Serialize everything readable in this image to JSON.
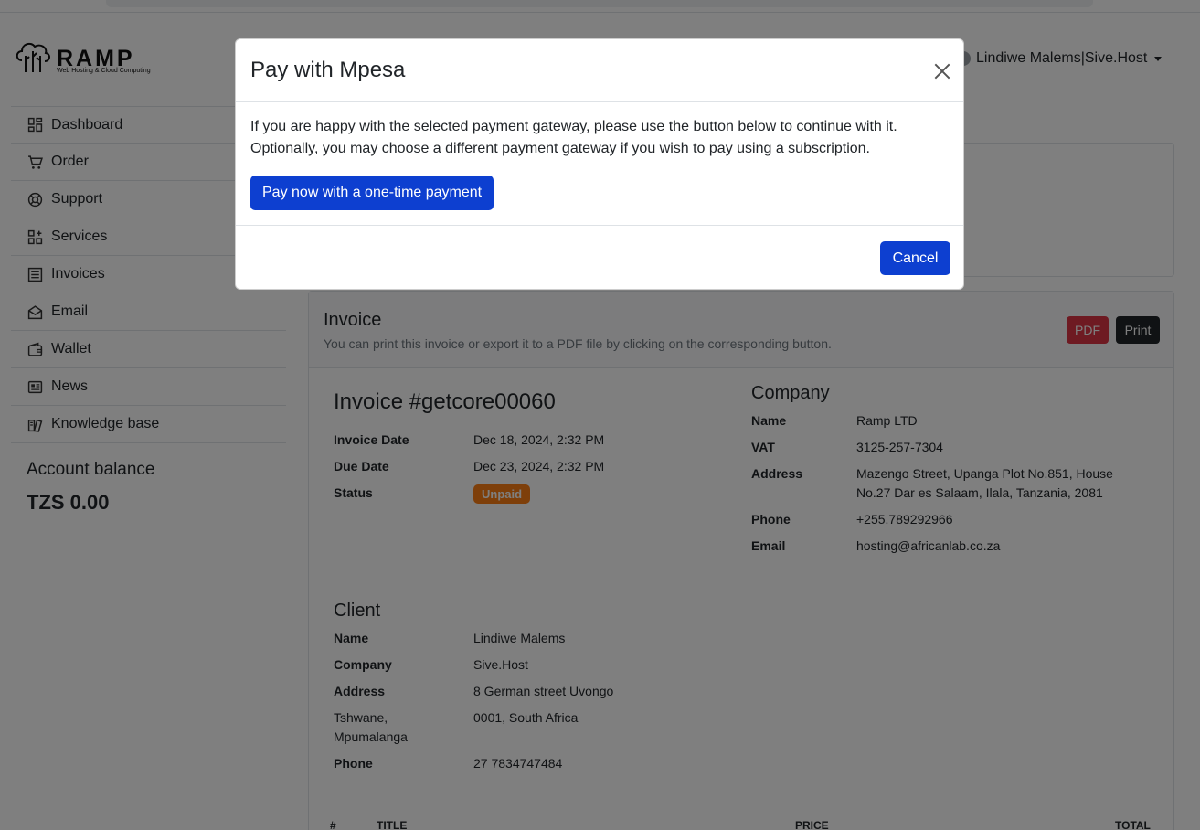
{
  "brand": {
    "name": "RAMP",
    "tagline": "Web Hosting & Cloud Computing"
  },
  "user_menu": {
    "label": "Lindiwe Malems|Sive.Host"
  },
  "sidebar": {
    "items": [
      {
        "label": "Dashboard",
        "icon": "dashboard-icon"
      },
      {
        "label": "Order",
        "icon": "cart-icon"
      },
      {
        "label": "Support",
        "icon": "lifebuoy-icon"
      },
      {
        "label": "Services",
        "icon": "grid-plus-icon"
      },
      {
        "label": "Invoices",
        "icon": "list-icon"
      },
      {
        "label": "Email",
        "icon": "envelope-open-icon"
      },
      {
        "label": "Wallet",
        "icon": "wallet-icon"
      },
      {
        "label": "News",
        "icon": "newspaper-icon"
      },
      {
        "label": "Knowledge base",
        "icon": "book-icon"
      }
    ],
    "balance_label": "Account balance",
    "balance_value": "TZS 0.00"
  },
  "invoice_card": {
    "title": "Invoice",
    "subtitle": "You can print this invoice or export it to a PDF file by clicking on the corresponding button.",
    "pdf_label": "PDF",
    "print_label": "Print"
  },
  "invoice": {
    "title": "Invoice #getcore00060",
    "date_label": "Invoice Date",
    "date_value": "Dec 18, 2024, 2:32 PM",
    "due_label": "Due Date",
    "due_value": "Dec 23, 2024, 2:32 PM",
    "status_label": "Status",
    "status_value": "Unpaid"
  },
  "company": {
    "heading": "Company",
    "name_label": "Name",
    "name_value": "Ramp LTD",
    "vat_label": "VAT",
    "vat_value": "3125-257-7304",
    "address_label": "Address",
    "address_line1": "Mazengo Street, Upanga Plot No.851, House",
    "address_line2": "No.27 Dar es Salaam, Ilala, Tanzania, 2081",
    "phone_label": "Phone",
    "phone_value": "+255.789292966",
    "email_label": "Email",
    "email_value": "hosting@africanlab.co.za"
  },
  "client": {
    "heading": "Client",
    "name_label": "Name",
    "name_value": "Lindiwe Malems",
    "company_label": "Company",
    "company_value": "Sive.Host",
    "address_label": "Address",
    "address_value": "8 German street Uvongo",
    "city_line1": "Tshwane,",
    "city_line2": "Mpumalanga",
    "postal_value": "0001, South Africa",
    "phone_label": "Phone",
    "phone_value": "27 7834747484"
  },
  "table": {
    "headers": [
      "#",
      "TITLE",
      "PRICE",
      "TOTAL"
    ]
  },
  "modal": {
    "title": "Pay with Mpesa",
    "text_line1": "If you are happy with the selected payment gateway, please use the button below to continue with it.",
    "text_line2": "Optionally, you may choose a different payment gateway if you wish to pay using a subscription.",
    "pay_label": "Pay now with a one-time payment",
    "cancel_label": "Cancel"
  },
  "colors": {
    "primary": "#0d3fd0",
    "danger": "#dc3545",
    "warning": "#fd7e14",
    "dark": "#212529"
  }
}
